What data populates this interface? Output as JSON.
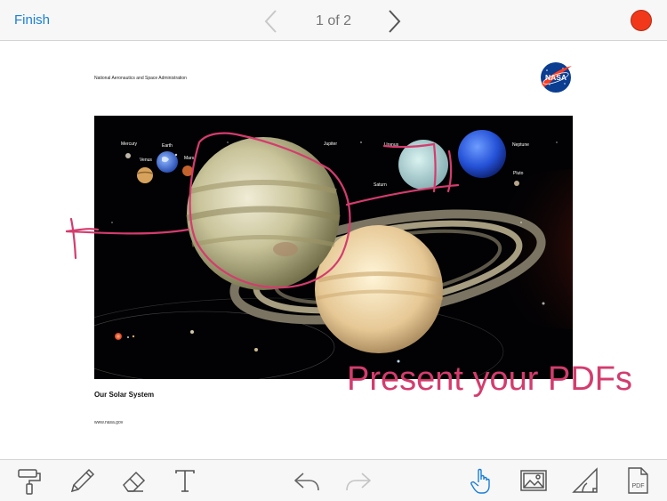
{
  "topbar": {
    "finish_label": "Finish",
    "page_indicator": "1 of 2",
    "record_color": "#f2381b"
  },
  "document": {
    "agency": "National Aeronautics and Space Administration",
    "logo_text": "NASA",
    "caption": "Our Solar System",
    "website": "www.nasa.gov",
    "planet_labels": {
      "mercury": "Mercury",
      "venus": "Venus",
      "earth": "Earth",
      "mars": "Mars",
      "jupiter": "Jupiter",
      "saturn": "Saturn",
      "uranus": "Uranus",
      "neptune": "Neptune",
      "pluto": "Pluto"
    }
  },
  "promo_text": "Present your PDFs",
  "annotation_color": "#d43c6e",
  "toolbar": {
    "icons": [
      "paint-roller-icon",
      "pencil-icon",
      "eraser-icon",
      "text-icon",
      "undo-icon",
      "redo-icon",
      "pointer-hand-icon",
      "image-icon",
      "shape-icon",
      "pdf-icon"
    ],
    "active_tool": "pointer-hand-icon",
    "active_color": "#1a7fd6",
    "pdf_label": "PDF"
  }
}
